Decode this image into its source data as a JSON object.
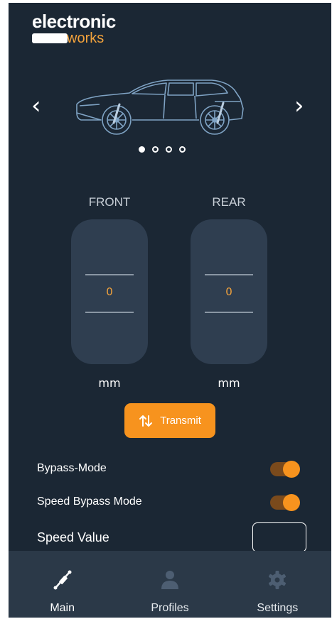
{
  "brand": {
    "logo_top": "electronic",
    "logo_bottom": "works",
    "accent": "#f7931e"
  },
  "carousel": {
    "prev_glyph": "‹",
    "next_glyph": "›",
    "page_count": 4,
    "active_page": 1
  },
  "axles": [
    {
      "label": "FRONT",
      "value": "0",
      "unit": "mm"
    },
    {
      "label": "REAR",
      "value": "0",
      "unit": "mm"
    }
  ],
  "actions": {
    "transmit_label": "Transmit"
  },
  "settings": {
    "bypass_mode": {
      "label": "Bypass-Mode",
      "on": true
    },
    "speed_bypass_mode": {
      "label": "Speed Bypass Mode",
      "on": true
    },
    "speed_value": {
      "label": "Speed Value",
      "value": ""
    }
  },
  "bottom_nav": [
    {
      "label": "Main",
      "icon": "shock-absorber-icon",
      "active": true
    },
    {
      "label": "Profiles",
      "icon": "user-icon",
      "active": false
    },
    {
      "label": "Settings",
      "icon": "gear-icon",
      "active": false
    }
  ]
}
